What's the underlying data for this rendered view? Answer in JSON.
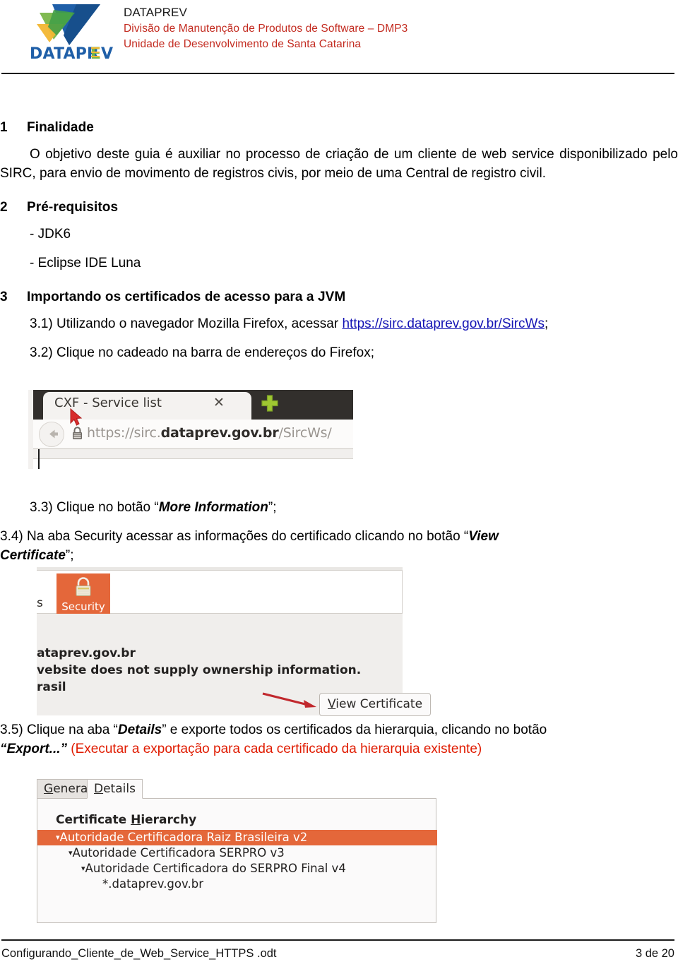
{
  "header": {
    "org": "DATAPREV",
    "division": "Divisão de Manutenção de Produtos de Software – DMP3",
    "unit": "Unidade de Desenvolvimento de Santa Catarina",
    "logo_wordmark": "DATAPREV",
    "colors": {
      "division_text": "#c32b20",
      "logo_blue": "#1f5fa8",
      "logo_green": "#7ab648",
      "logo_yellow": "#f2b632"
    }
  },
  "sections": [
    {
      "number": "1",
      "title": "Finalidade"
    },
    {
      "number": "2",
      "title": "Pré-requisitos"
    },
    {
      "number": "3",
      "title": "Importando os certificados de acesso para a JVM"
    }
  ],
  "finalidade": {
    "paragraph": "O objetivo deste  guia é auxiliar no processo de criação de um cliente de web service disponibilizado pelo SIRC, para envio de movimento de registros civis, por meio de uma Central de registro civil."
  },
  "prerequisitos": {
    "items": [
      "- JDK6",
      "- Eclipse IDE Luna"
    ]
  },
  "steps": {
    "s31_prefix": "3.1) Utilizando o navegador Mozilla Firefox, acessar ",
    "s31_link": "https://sirc.dataprev.gov.br/SircWs",
    "s31_suffix": ";",
    "s32": "3.2) Clique no cadeado na barra de endereços do Firefox;",
    "s33_prefix": "3.3) Clique no botão “",
    "s33_bold": "More Information",
    "s33_suffix": "”;",
    "s34_prefix": "3.4) Na aba Security acessar as informações do certificado clicando no botão “",
    "s34_bold": "View",
    "s34_bold2": "Certificate",
    "s34_suffix": "”;",
    "s35_prefix": "3.5) Clique na aba “",
    "s35_bold1": "Details",
    "s35_mid": "” e exporte todos os certificados da hierarquia, clicando no botão ",
    "s35_bold2": "“Export...”",
    "s35_red": " (Executar a exportação para cada certificado da hierarquia existente)"
  },
  "figure_firefox": {
    "tab_title": "CXF - Service list",
    "tab_close_glyph": "✕",
    "new_tab_glyph": "+",
    "url_protocol": "https://sirc.",
    "url_domain": "dataprev.gov.br",
    "url_path": "/SircWs/",
    "padlock": "padlock-icon",
    "back_arrow": "back-arrow-icon",
    "cursor": "mouse-cursor"
  },
  "figure_security": {
    "left_partial_label": "s",
    "tab_label": "Security",
    "tab_color": "#e4673a",
    "line1": "ataprev.gov.br",
    "line2": "vebsite does not supply ownership information.",
    "line3": "rasil",
    "button_mnemonic": "V",
    "button_rest": "iew Certificate",
    "arrow_color": "#c1282d"
  },
  "figure_certificate": {
    "tabs": [
      {
        "mnemonic": "G",
        "rest": "eneral",
        "selected": false
      },
      {
        "mnemonic": "D",
        "rest": "etails",
        "selected": true
      }
    ],
    "panel_title_prefix": "Certificate ",
    "panel_title_mnemonic": "H",
    "panel_title_rest": "ierarchy",
    "nodes": [
      {
        "text": "Autoridade Certificadora Raiz Brasileira v2",
        "twisty": "▾",
        "indent": 0,
        "selected": true
      },
      {
        "text": "Autoridade Certificadora SERPRO v3",
        "twisty": "▾",
        "indent": 1,
        "selected": false
      },
      {
        "text": "Autoridade Certificadora do SERPRO Final v4",
        "twisty": "▾",
        "indent": 2,
        "selected": false
      },
      {
        "text": "*.dataprev.gov.br",
        "twisty": "",
        "indent": 3,
        "selected": false
      }
    ],
    "selection_color": "#e4673a"
  },
  "footer": {
    "filename": "Configurando_Cliente_de_Web_Service_HTTPS .odt",
    "page": "3 de 20"
  }
}
